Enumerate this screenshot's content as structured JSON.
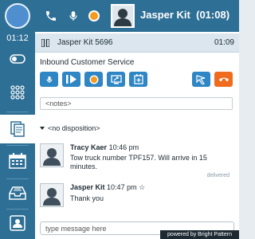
{
  "agent": {
    "name": "Jasper Kit",
    "timer": "(01:08)"
  },
  "sidebar": {
    "time": "01:12"
  },
  "call": {
    "title": "Jasper Kit 5696",
    "duration": "01:09",
    "queue": "Inbound Customer Service"
  },
  "notes": {
    "placeholder": "<notes>"
  },
  "disposition": {
    "label": "<no disposition>"
  },
  "messages": [
    {
      "sender": "Tracy Kaer",
      "time": "10:46 pm",
      "star": "",
      "text": "Tow truck number TPF157. Will arrive in 15 minutes.",
      "status": "delivered"
    },
    {
      "sender": "Jasper Kit",
      "time": "10:47 pm",
      "star": "☆",
      "text": "Thank you",
      "status": ""
    }
  ],
  "compose": {
    "placeholder": "type message here"
  },
  "footer": {
    "powered_by": "powered by Bright Pattern"
  },
  "colors": {
    "primary": "#2e6f95",
    "button_blue": "#2f86c4",
    "hangup": "#ef6c1e",
    "status": "#4f8fd0"
  }
}
